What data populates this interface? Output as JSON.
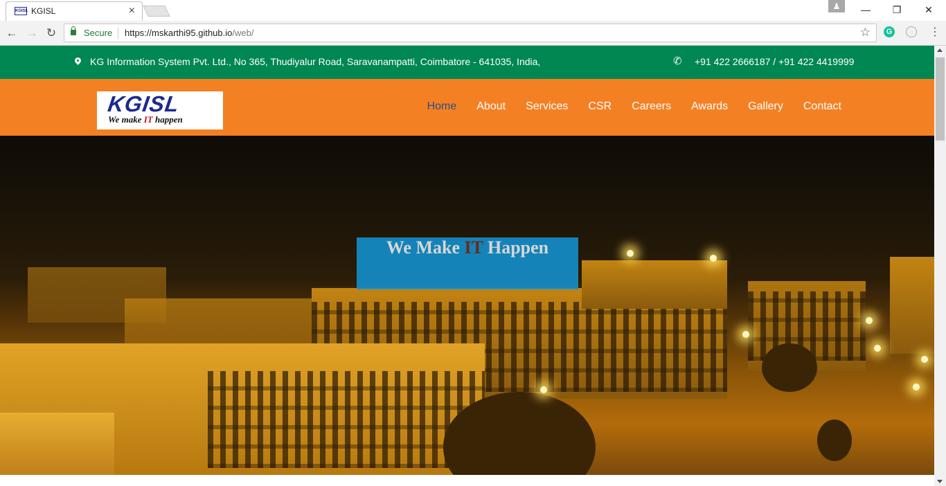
{
  "browser": {
    "tab_title": "KGISL",
    "tab_favicon_text": "KGISL",
    "close_glyph": "×",
    "secure_label": "Secure",
    "url_host": "https://mskarthi95.github.io",
    "url_path": "/web/",
    "extension_g": "G",
    "extension_o": "◌",
    "window_buttons": {
      "minimize": "—",
      "restore": "❐",
      "close": "✕"
    }
  },
  "contact_bar": {
    "address": "KG Information System Pvt. Ltd., No 365, Thudiyalur Road, Saravanampatti, Coimbatore - 641035, India,",
    "phone": "+91 422 2666187 / +91 422 4419999"
  },
  "logo": {
    "brand": "KGISL",
    "tagline_before": "We make ",
    "tagline_it": "IT",
    "tagline_after": " happen"
  },
  "nav": {
    "items": [
      {
        "label": "Home",
        "active": true
      },
      {
        "label": "About"
      },
      {
        "label": "Services"
      },
      {
        "label": "CSR"
      },
      {
        "label": "Careers"
      },
      {
        "label": "Awards"
      },
      {
        "label": "Gallery"
      },
      {
        "label": "Contact"
      }
    ]
  },
  "hero": {
    "headline_before": "We Make ",
    "headline_it": "IT",
    "headline_after": " Happen"
  },
  "colors": {
    "contact_bar": "#008752",
    "navbar": "#f48024",
    "nav_active": "#2d4f8a",
    "banner": "#1292d0",
    "logo_blue": "#1b2a8f",
    "logo_red": "#c0141b"
  }
}
